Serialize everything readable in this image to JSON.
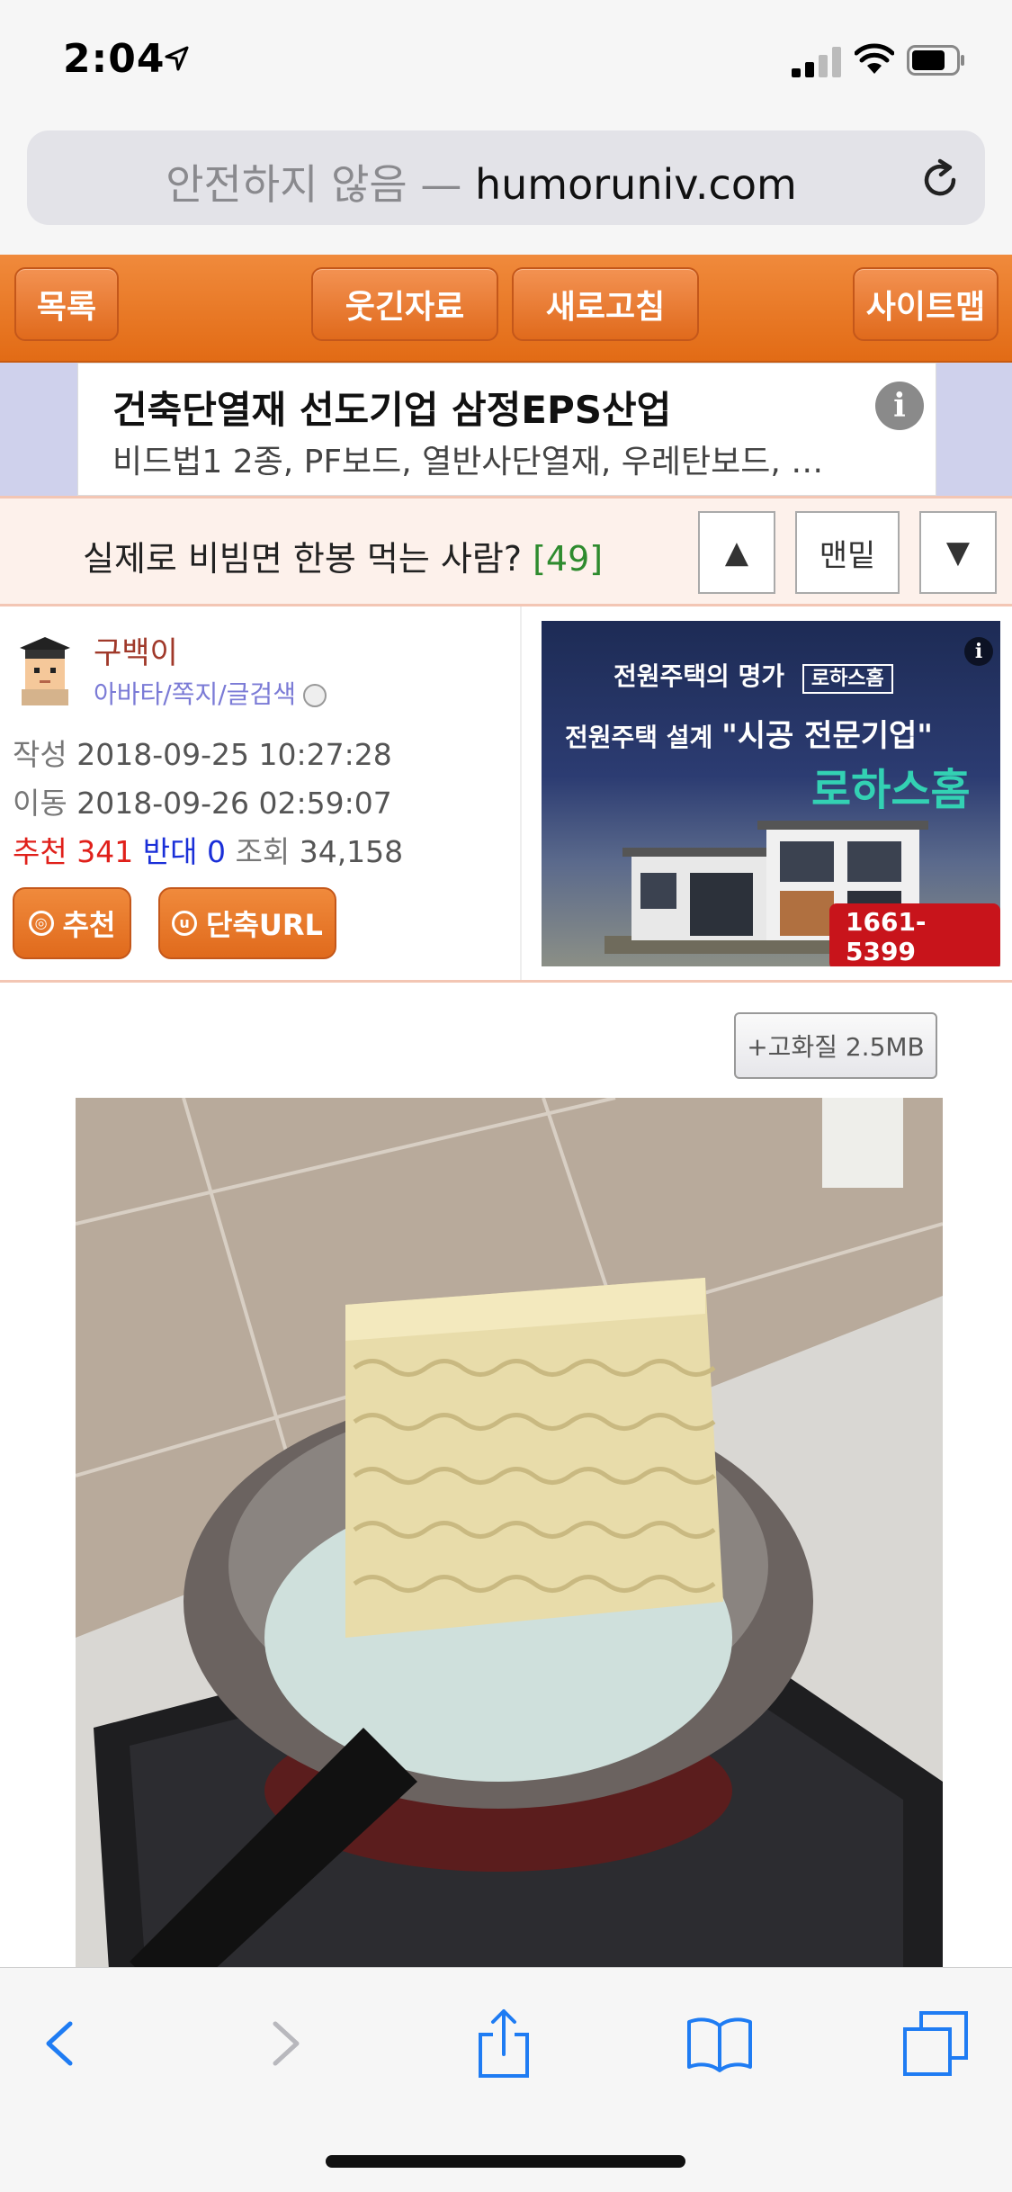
{
  "status_bar": {
    "time": "2:04"
  },
  "address_bar": {
    "prefix": "안전하지 않음 — ",
    "domain": "humoruniv.com"
  },
  "nav": {
    "list": "목록",
    "funny": "웃긴자료",
    "refresh": "새로고침",
    "sitemap": "사이트맵"
  },
  "ad_banner": {
    "title": "건축단열재 선도기업 삼정EPS산업",
    "description": "비드법1 2종, PF보드, 열반사단열재, 우레탄보드, …",
    "info_glyph": "i"
  },
  "post": {
    "title": "실제로 비빔면 한봉 먹는 사람?",
    "comment_count": "[49]",
    "up_label": "▲",
    "bottom_label": "맨밑",
    "down_label": "▼"
  },
  "author": {
    "name": "구백이",
    "links": "아바타/쪽지/글검색",
    "written_label": "작성",
    "written": "2018-09-25 10:27:28",
    "moved_label": "이동",
    "moved": "2018-09-26 02:59:07",
    "recommend_label": "추천",
    "recommend": "341",
    "oppose_label": "반대",
    "oppose": "0",
    "views_label": "조회",
    "views": "34,158"
  },
  "actions": {
    "recommend": "추천",
    "short_url": "단축URL",
    "recommend_glyph": "◎",
    "short_url_glyph": "u"
  },
  "ad2": {
    "line1": "전원주택의 명가",
    "logo_small": "로하스홈",
    "line2_prefix": "전원주택 설계",
    "line2_main": "\"시공 전문기업\"",
    "brand": "로하스홈",
    "phone": "1661-5399",
    "info_glyph": "i"
  },
  "content": {
    "hq_button": "+고화질 2.5MB"
  },
  "colors": {
    "nav_orange": "#e8772a",
    "title_bg": "#fdf1eb",
    "comment_green": "#2e8b2e",
    "ios_blue": "#1f7cf3"
  },
  "icons": [
    "location-arrow-icon",
    "signal-icon",
    "wifi-icon",
    "battery-icon",
    "reload-icon",
    "back-icon",
    "forward-icon",
    "share-icon",
    "bookmarks-icon",
    "tabs-icon"
  ]
}
